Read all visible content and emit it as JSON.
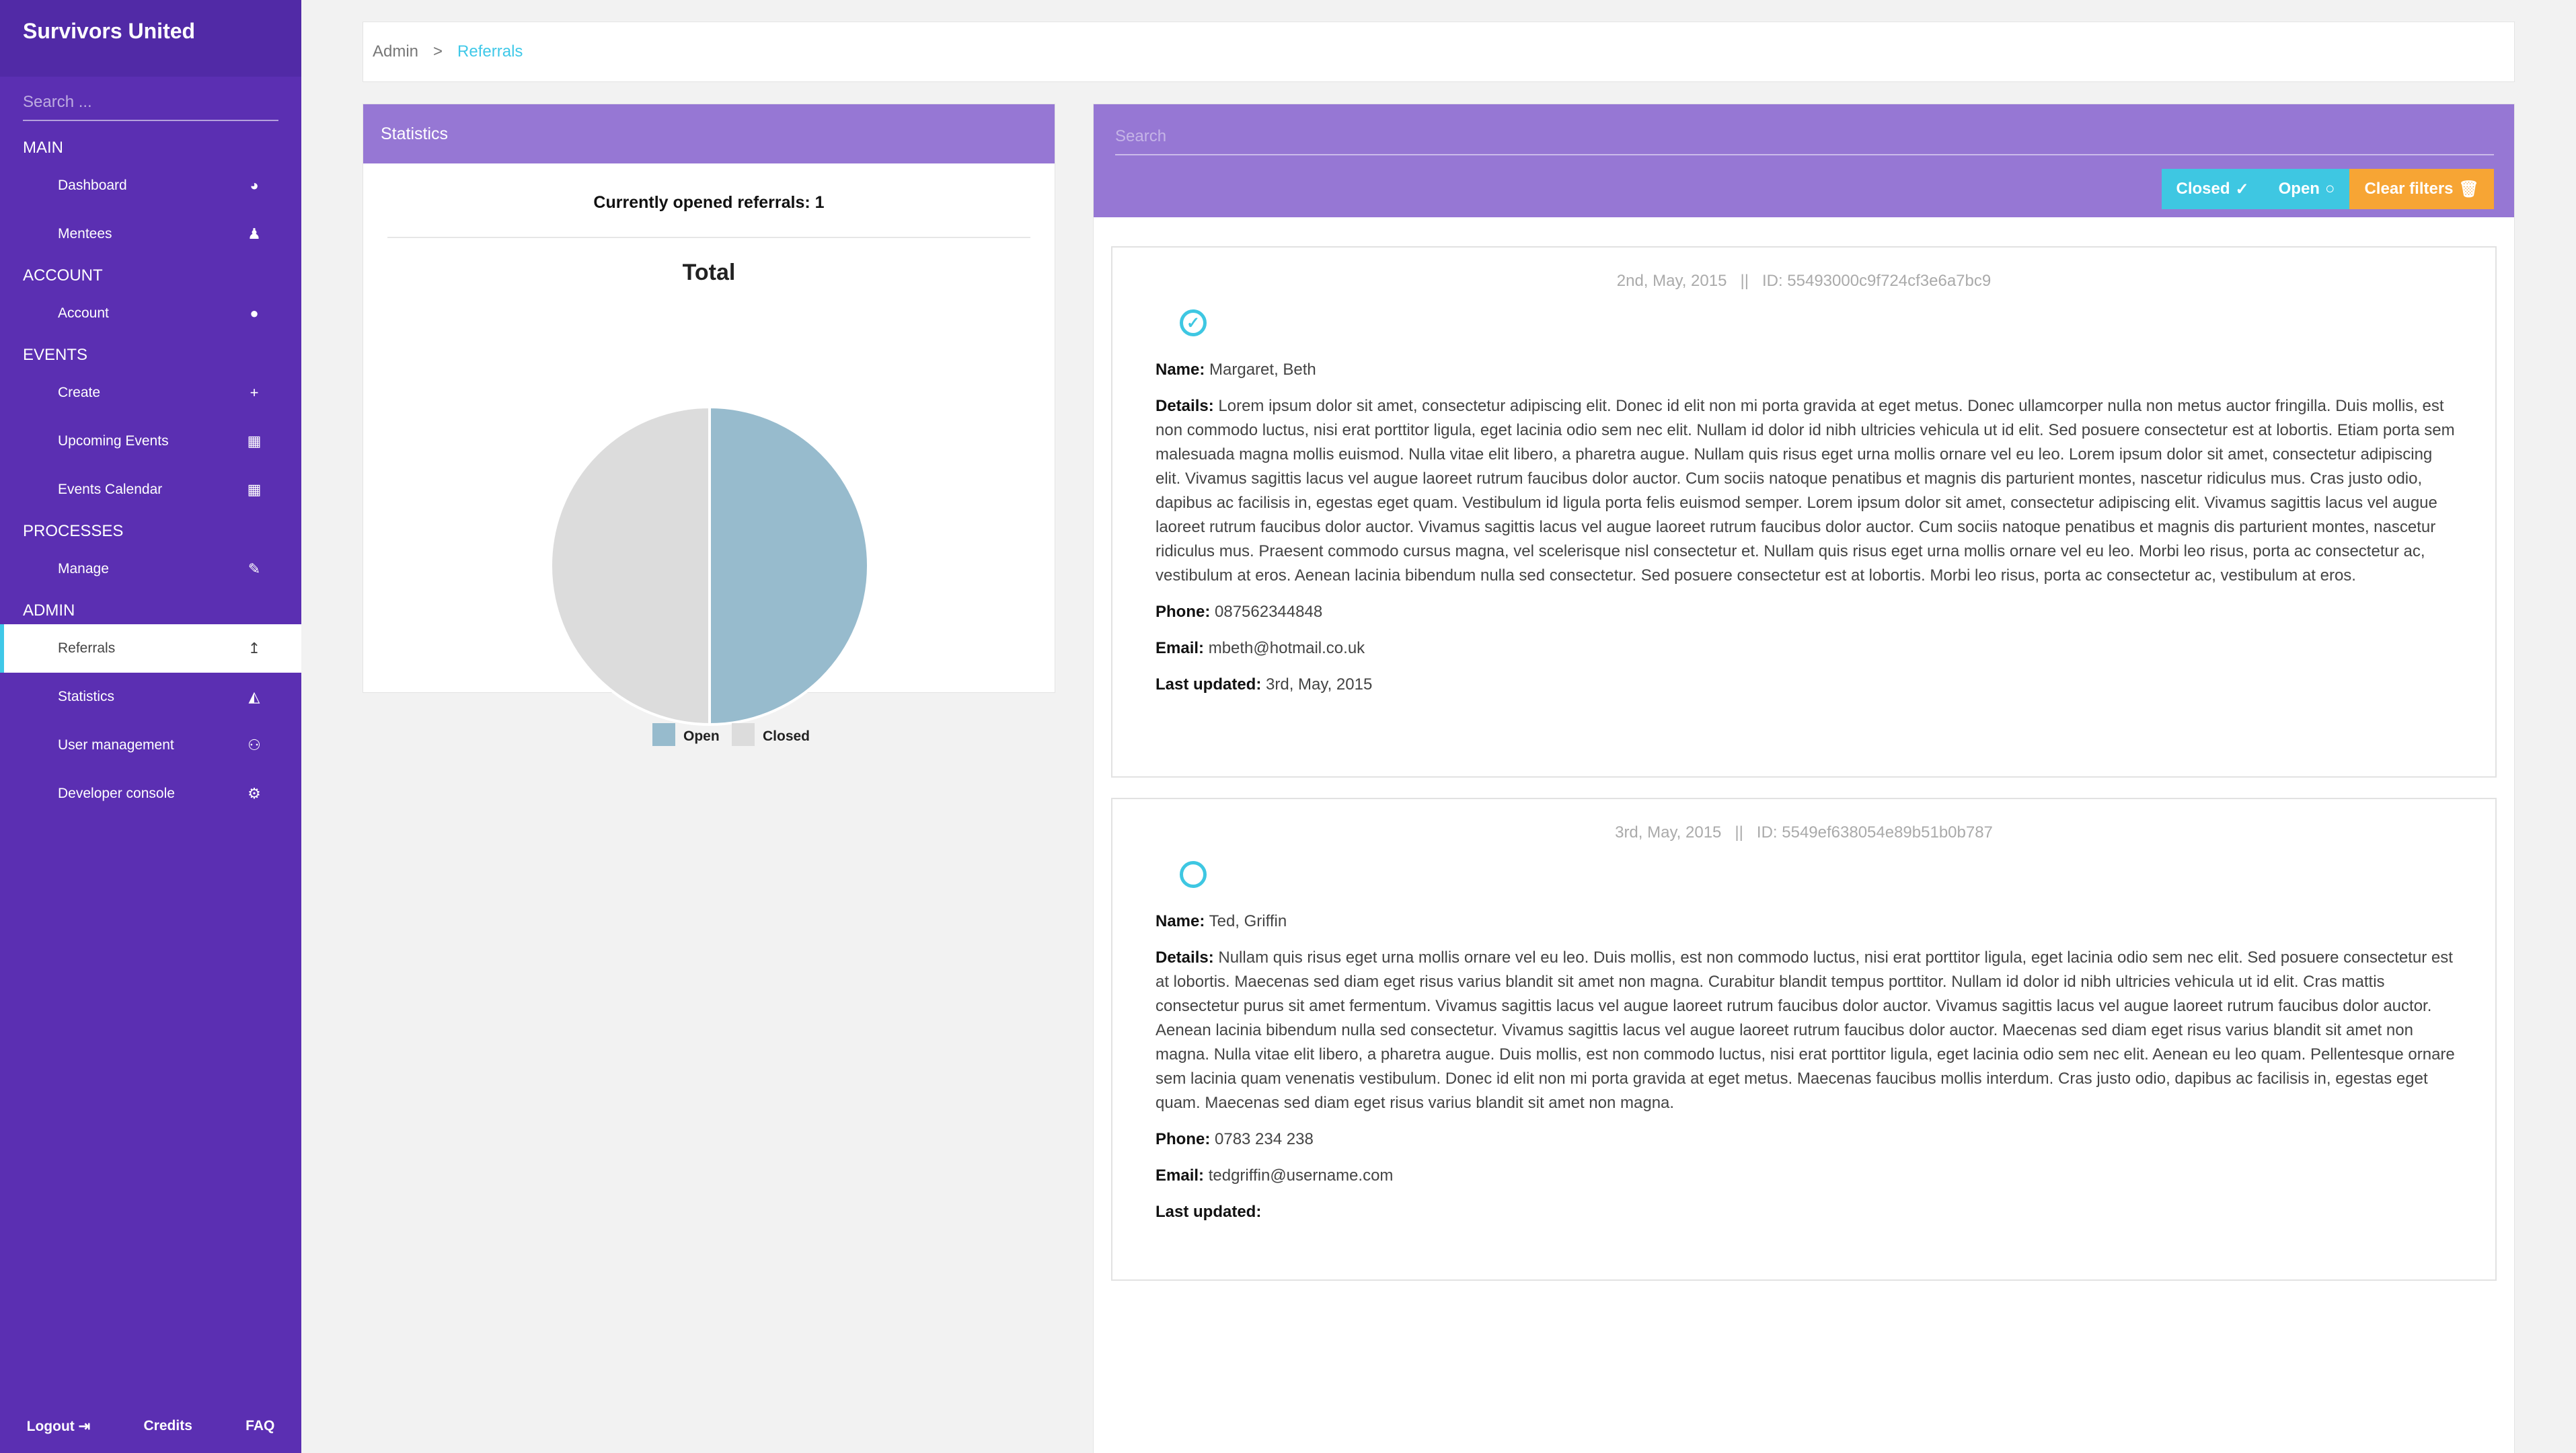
{
  "brand": "Survivors United",
  "sidebar_search_placeholder": "Search ...",
  "sections": {
    "main": "MAIN",
    "account": "ACCOUNT",
    "events": "EVENTS",
    "processes": "PROCESSES",
    "admin": "ADMIN"
  },
  "nav": {
    "dashboard": "Dashboard",
    "mentees": "Mentees",
    "account": "Account",
    "create": "Create",
    "upcoming_events": "Upcoming Events",
    "events_calendar": "Events Calendar",
    "manage": "Manage",
    "referrals": "Referrals",
    "statistics": "Statistics",
    "user_management": "User management",
    "developer_console": "Developer console"
  },
  "footer": {
    "logout": "Logout",
    "credits": "Credits",
    "faq": "FAQ"
  },
  "breadcrumb": {
    "parent": "Admin",
    "separator": ">",
    "current": "Referrals"
  },
  "stats": {
    "header": "Statistics",
    "opened_text": "Currently opened referrals: 1",
    "chart_title": "Total"
  },
  "chart_data": {
    "type": "pie",
    "title": "Total",
    "categories": [
      "Open",
      "Closed"
    ],
    "values": [
      1,
      1
    ],
    "colors": [
      "#97bbcd",
      "#dcdcdc"
    ],
    "legend": "bottom"
  },
  "list": {
    "search_placeholder": "Search",
    "filters": {
      "closed": "Closed",
      "open": "Open",
      "clear": "Clear filters"
    }
  },
  "labels": {
    "name": "Name:",
    "details": "Details:",
    "phone": "Phone:",
    "email": "Email:",
    "last_updated": "Last updated:"
  },
  "referrals": [
    {
      "date": "2nd, May, 2015",
      "separator": "||",
      "id": "ID: 55493000c9f724cf3e6a7bc9",
      "status": "closed",
      "name": "Margaret, Beth",
      "details": "Lorem ipsum dolor sit amet, consectetur adipiscing elit. Donec id elit non mi porta gravida at eget metus. Donec ullamcorper nulla non metus auctor fringilla. Duis mollis, est non commodo luctus, nisi erat porttitor ligula, eget lacinia odio sem nec elit. Nullam id dolor id nibh ultricies vehicula ut id elit. Sed posuere consectetur est at lobortis. Etiam porta sem malesuada magna mollis euismod. Nulla vitae elit libero, a pharetra augue. Nullam quis risus eget urna mollis ornare vel eu leo. Lorem ipsum dolor sit amet, consectetur adipiscing elit. Vivamus sagittis lacus vel augue laoreet rutrum faucibus dolor auctor. Cum sociis natoque penatibus et magnis dis parturient montes, nascetur ridiculus mus. Cras justo odio, dapibus ac facilisis in, egestas eget quam. Vestibulum id ligula porta felis euismod semper. Lorem ipsum dolor sit amet, consectetur adipiscing elit. Vivamus sagittis lacus vel augue laoreet rutrum faucibus dolor auctor. Vivamus sagittis lacus vel augue laoreet rutrum faucibus dolor auctor. Cum sociis natoque penatibus et magnis dis parturient montes, nascetur ridiculus mus. Praesent commodo cursus magna, vel scelerisque nisl consectetur et. Nullam quis risus eget urna mollis ornare vel eu leo. Morbi leo risus, porta ac consectetur ac, vestibulum at eros. Aenean lacinia bibendum nulla sed consectetur. Sed posuere consectetur est at lobortis. Morbi leo risus, porta ac consectetur ac, vestibulum at eros.",
      "phone": "087562344848",
      "email": "mbeth@hotmail.co.uk",
      "last_updated": "3rd, May, 2015"
    },
    {
      "date": "3rd, May, 2015",
      "separator": "||",
      "id": "ID: 5549ef638054e89b51b0b787",
      "status": "open",
      "name": "Ted, Griffin",
      "details": "Nullam quis risus eget urna mollis ornare vel eu leo. Duis mollis, est non commodo luctus, nisi erat porttitor ligula, eget lacinia odio sem nec elit. Sed posuere consectetur est at lobortis. Maecenas sed diam eget risus varius blandit sit amet non magna. Curabitur blandit tempus porttitor. Nullam id dolor id nibh ultricies vehicula ut id elit. Cras mattis consectetur purus sit amet fermentum. Vivamus sagittis lacus vel augue laoreet rutrum faucibus dolor auctor. Vivamus sagittis lacus vel augue laoreet rutrum faucibus dolor auctor. Aenean lacinia bibendum nulla sed consectetur. Vivamus sagittis lacus vel augue laoreet rutrum faucibus dolor auctor. Maecenas sed diam eget risus varius blandit sit amet non magna. Nulla vitae elit libero, a pharetra augue. Duis mollis, est non commodo luctus, nisi erat porttitor ligula, eget lacinia odio sem nec elit. Aenean eu leo quam. Pellentesque ornare sem lacinia quam venenatis vestibulum. Donec id elit non mi porta gravida at eget metus. Maecenas faucibus mollis interdum. Cras justo odio, dapibus ac facilisis in, egestas eget quam. Maecenas sed diam eget risus varius blandit sit amet non magna.",
      "phone": "0783 234 238",
      "email": "tedgriffin@username.com",
      "last_updated": ""
    }
  ]
}
